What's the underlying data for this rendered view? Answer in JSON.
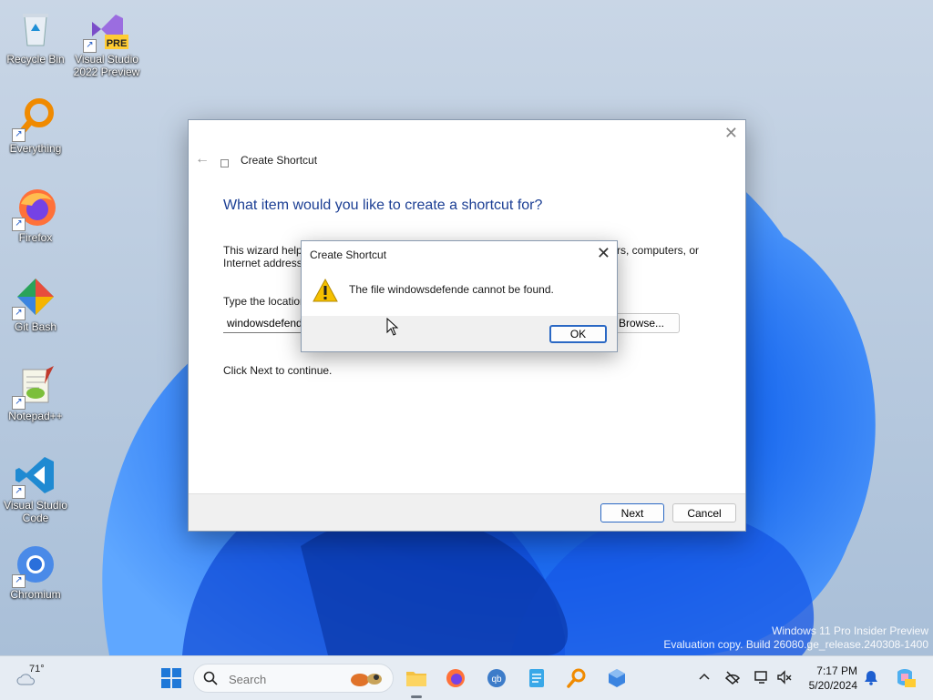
{
  "desktop": {
    "icons": [
      {
        "label": "Recycle Bin",
        "icon": "recycle-bin-icon"
      },
      {
        "label": "Visual Studio 2022 Preview",
        "icon": "visual-studio-icon",
        "badge": "PRE"
      },
      {
        "label": "Everything",
        "icon": "everything-icon"
      },
      {
        "label": "Firefox",
        "icon": "firefox-icon"
      },
      {
        "label": "Git Bash",
        "icon": "git-bash-icon"
      },
      {
        "label": "Notepad++",
        "icon": "notepadpp-icon"
      },
      {
        "label": "Visual Studio Code",
        "icon": "vscode-icon"
      },
      {
        "label": "Chromium",
        "icon": "chromium-icon"
      }
    ]
  },
  "wizard": {
    "title": "Create Shortcut",
    "heading": "What item would you like to create a shortcut for?",
    "description_visible_left": "This wizard help",
    "description_visible_left2": "Internet address",
    "description_visible_right": "rs, computers, or",
    "location_label_visible": "Type the location",
    "location_value": "windowsdefende",
    "browse_label": "Browse...",
    "hint": "Click Next to continue.",
    "next_label": "Next",
    "cancel_label": "Cancel"
  },
  "msgbox": {
    "title": "Create Shortcut",
    "message": "The file windowsdefende cannot be found.",
    "ok_label": "OK"
  },
  "watermark": {
    "line1": "Windows 11 Pro Insider Preview",
    "line2": "Evaluation copy. Build 26080.ge_release.240308-1400"
  },
  "taskbar": {
    "weather_temp": "71°",
    "search_placeholder": "Search",
    "clock_time": "7:17 PM",
    "clock_date": "5/20/2024"
  },
  "colors": {
    "accent": "#2a68c4",
    "heading": "#1c3f94",
    "taskbar": "#e6ecf3"
  }
}
